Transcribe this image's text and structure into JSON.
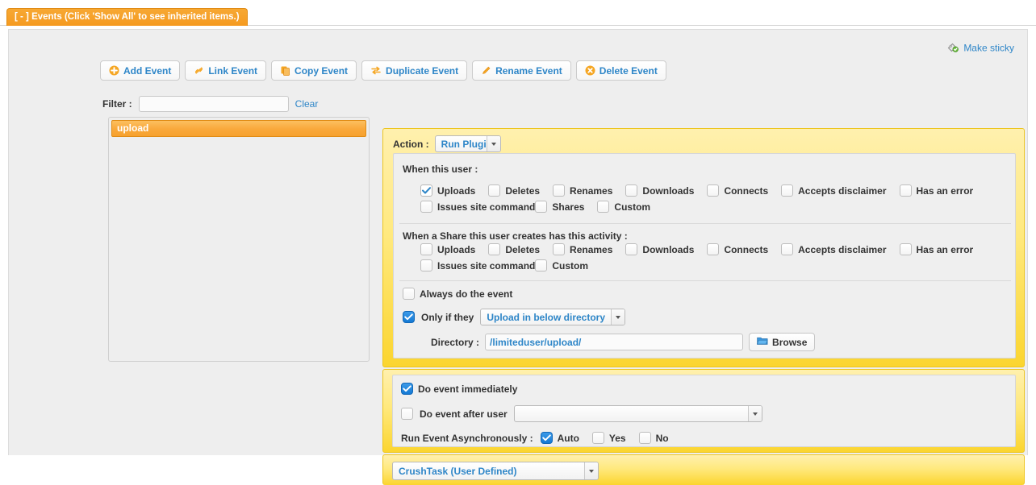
{
  "tab": {
    "label": "[ - ] Events (Click 'Show All' to see inherited items.)"
  },
  "sticky": {
    "label": "Make sticky",
    "icon": "sticky-tag-icon"
  },
  "toolbar": {
    "buttons": [
      {
        "label": "Add Event",
        "icon": "plus-circle-icon"
      },
      {
        "label": "Link Event",
        "icon": "link-icon"
      },
      {
        "label": "Copy Event",
        "icon": "copy-icon"
      },
      {
        "label": "Duplicate Event",
        "icon": "duplicate-arrows-icon"
      },
      {
        "label": "Rename Event",
        "icon": "pencil-icon"
      },
      {
        "label": "Delete Event",
        "icon": "x-circle-icon"
      }
    ]
  },
  "filter": {
    "label": "Filter :",
    "value": "",
    "placeholder": "",
    "clear_label": "Clear"
  },
  "event_list": {
    "items": [
      {
        "label": "upload",
        "selected": true
      }
    ]
  },
  "action": {
    "label": "Action :",
    "selected": "Run Plugin"
  },
  "when_user": {
    "title": "When this user :",
    "options": [
      {
        "label": "Uploads",
        "checked": true
      },
      {
        "label": "Deletes",
        "checked": false
      },
      {
        "label": "Renames",
        "checked": false
      },
      {
        "label": "Downloads",
        "checked": false
      },
      {
        "label": "Connects",
        "checked": false
      },
      {
        "label": "Accepts disclaimer",
        "checked": false
      },
      {
        "label": "Has an error",
        "checked": false
      },
      {
        "label": "Issues site command",
        "checked": false
      },
      {
        "label": "Shares",
        "checked": false
      },
      {
        "label": "Custom",
        "checked": false
      }
    ]
  },
  "when_share": {
    "title": "When a Share this user creates has this activity :",
    "options": [
      {
        "label": "Uploads",
        "checked": false
      },
      {
        "label": "Deletes",
        "checked": false
      },
      {
        "label": "Renames",
        "checked": false
      },
      {
        "label": "Downloads",
        "checked": false
      },
      {
        "label": "Connects",
        "checked": false
      },
      {
        "label": "Accepts disclaimer",
        "checked": false
      },
      {
        "label": "Has an error",
        "checked": false
      },
      {
        "label": "Issues site command",
        "checked": false
      },
      {
        "label": "Custom",
        "checked": false
      }
    ]
  },
  "conditions": {
    "always_label": "Always do the event",
    "always_checked": false,
    "only_if_label": "Only if they",
    "only_if_checked": true,
    "only_if_selected": "Upload in below directory",
    "directory_label": "Directory :",
    "directory_value": "/limiteduser/upload/",
    "browse_label": "Browse",
    "browse_icon": "folder-icon"
  },
  "timing": {
    "immediate_label": "Do event immediately",
    "immediate_checked": true,
    "after_user_label": "Do event after user",
    "after_user_checked": false,
    "after_user_value": "",
    "async_label": "Run Event Asynchronously :",
    "async_options": [
      {
        "label": "Auto",
        "checked": true
      },
      {
        "label": "Yes",
        "checked": false
      },
      {
        "label": "No",
        "checked": false
      }
    ]
  },
  "task": {
    "selected": "CrushTask (User Defined)"
  },
  "colors": {
    "accent_blue": "#2e86c8",
    "accent_orange": "#f59a20",
    "panel_yellow_top": "#fff0ae",
    "panel_yellow_bottom": "#fbd52f",
    "checked_blue": "#1479d4"
  }
}
